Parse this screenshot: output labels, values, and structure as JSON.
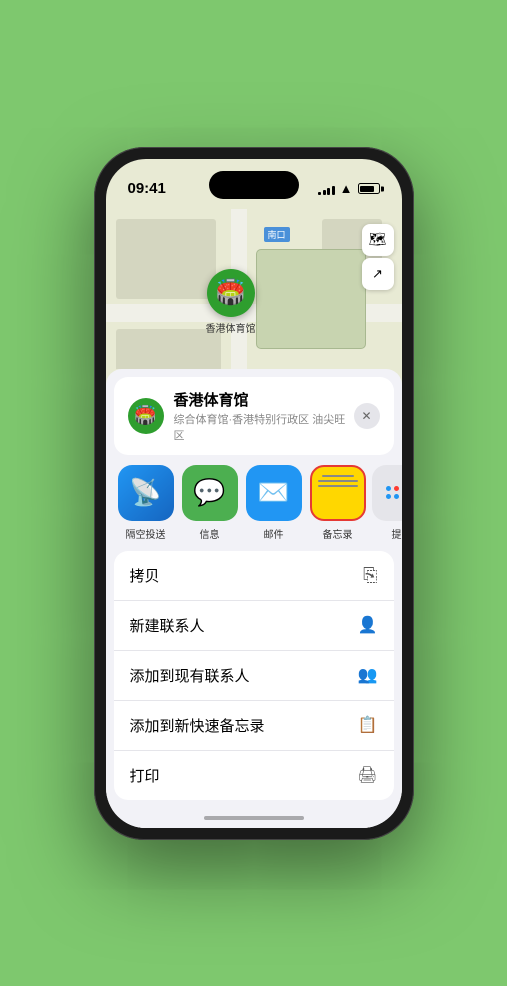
{
  "status_bar": {
    "time": "09:41",
    "signal_bars": [
      3,
      5,
      7,
      9,
      11
    ],
    "battery_level": 80
  },
  "map": {
    "label": "南口",
    "map_button_label": "🗺",
    "location_button_label": "↗"
  },
  "location_card": {
    "name": "香港体育馆",
    "subtitle": "综合体育馆·香港特别行政区 油尖旺区",
    "close_label": "✕"
  },
  "share_items": [
    {
      "id": "airdrop",
      "label": "隔空投送",
      "icon": "📡"
    },
    {
      "id": "messages",
      "label": "信息",
      "icon": "💬"
    },
    {
      "id": "mail",
      "label": "邮件",
      "icon": "✉"
    },
    {
      "id": "notes",
      "label": "备忘录",
      "icon": ""
    },
    {
      "id": "more",
      "label": "提"
    }
  ],
  "action_items": [
    {
      "id": "copy",
      "label": "拷贝",
      "icon": "⎘"
    },
    {
      "id": "new-contact",
      "label": "新建联系人",
      "icon": "👤"
    },
    {
      "id": "add-existing",
      "label": "添加到现有联系人",
      "icon": "👤+"
    },
    {
      "id": "add-notes",
      "label": "添加到新快速备忘录",
      "icon": "📋"
    },
    {
      "id": "print",
      "label": "打印",
      "icon": "🖨"
    }
  ],
  "stadium": {
    "name": "香港体育馆",
    "pin_emoji": "🏟️"
  }
}
